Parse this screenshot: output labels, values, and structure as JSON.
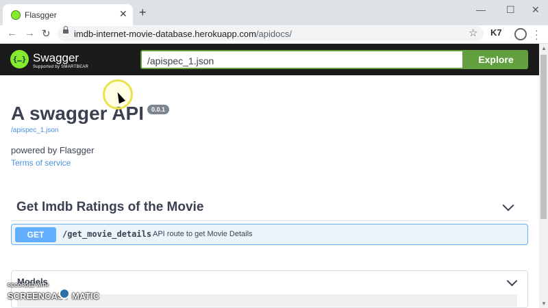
{
  "browser": {
    "tab_title": "Flasgger",
    "new_tab_icon": "+",
    "close_icon": "✕",
    "url_host": "imdb-internet-movie-database.herokuapp.com",
    "url_path": "/apidocs/",
    "extension_label": "K7"
  },
  "swagger": {
    "brand": "Swagger",
    "tagline": "Supported by SMARTBEAR",
    "logo_glyph": "{…}",
    "spec_input_value": "/apispec_1.json",
    "explore_label": "Explore",
    "accent_color": "#62a03f"
  },
  "info": {
    "title": "A swagger API",
    "version": "0.0.1",
    "spec_link": "/apispec_1.json",
    "description": "powered by Flasgger",
    "terms_link": "Terms of service"
  },
  "sections": [
    {
      "title": "Get Imdb Ratings of the Movie",
      "operations": [
        {
          "method": "GET",
          "path": "/get_movie_details",
          "summary": "API route to get Movie Details"
        }
      ]
    }
  ],
  "models": {
    "title": "Models"
  },
  "watermark": {
    "line1": "RECORDED WITH",
    "left": "SCREENCAST",
    "right": "MATIC"
  }
}
